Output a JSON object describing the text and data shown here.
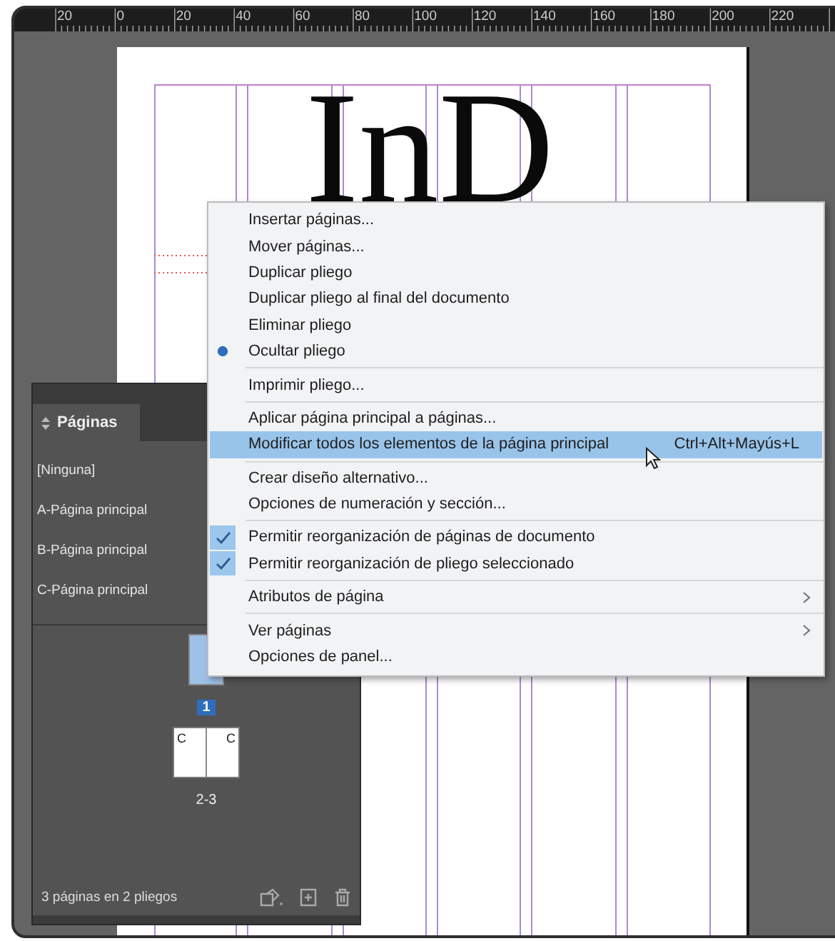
{
  "ruler": {
    "labels": [
      "20",
      "0",
      "20",
      "40",
      "60",
      "80",
      "100",
      "120",
      "140",
      "160",
      "180",
      "200",
      "220"
    ]
  },
  "document": {
    "text": "InD"
  },
  "pages_panel": {
    "title": "Páginas",
    "parents": [
      {
        "label": "[Ninguna]",
        "selected": false
      },
      {
        "label": "A-Página principal",
        "selected": false
      },
      {
        "label": "B-Página principal",
        "selected": false
      },
      {
        "label": "C-Página principal",
        "selected": false
      }
    ],
    "pages": [
      {
        "kind": "single",
        "label": "1",
        "selected": true
      },
      {
        "kind": "spread",
        "label": "2-3",
        "selected": false,
        "parent_letters": [
          "C",
          "C"
        ]
      }
    ],
    "footer": "3 páginas en 2 pliegos"
  },
  "menu": {
    "items": [
      {
        "kind": "item",
        "label": "Insertar páginas...",
        "highlighted": false
      },
      {
        "kind": "item",
        "label": "Mover páginas...",
        "highlighted": false
      },
      {
        "kind": "item",
        "label": "Duplicar pliego",
        "highlighted": false
      },
      {
        "kind": "item",
        "label": "Duplicar pliego al final del documento",
        "highlighted": false
      },
      {
        "kind": "item",
        "label": "Eliminar pliego",
        "highlighted": false
      },
      {
        "kind": "radio",
        "label": "Ocultar pliego",
        "checked": true,
        "highlighted": false
      },
      {
        "kind": "separator"
      },
      {
        "kind": "item",
        "label": "Imprimir pliego...",
        "highlighted": false
      },
      {
        "kind": "separator"
      },
      {
        "kind": "item",
        "label": "Aplicar página principal a páginas...",
        "highlighted": false
      },
      {
        "kind": "item",
        "label": "Modificar todos los elementos de la página principal",
        "shortcut": "Ctrl+Alt+Mayús+L",
        "highlighted": true
      },
      {
        "kind": "separator"
      },
      {
        "kind": "item",
        "label": "Crear diseño alternativo...",
        "highlighted": false
      },
      {
        "kind": "item",
        "label": "Opciones de numeración y sección...",
        "highlighted": false
      },
      {
        "kind": "separator"
      },
      {
        "kind": "check",
        "label": "Permitir reorganización de páginas de documento",
        "checked": true,
        "highlighted": false
      },
      {
        "kind": "check",
        "label": "Permitir reorganización de pliego seleccionado",
        "checked": true,
        "highlighted": false
      },
      {
        "kind": "separator"
      },
      {
        "kind": "submenu",
        "label": "Atributos de página",
        "highlighted": false
      },
      {
        "kind": "separator"
      },
      {
        "kind": "submenu",
        "label": "Ver páginas",
        "highlighted": false
      },
      {
        "kind": "item",
        "label": "Opciones de panel...",
        "highlighted": false
      }
    ]
  }
}
